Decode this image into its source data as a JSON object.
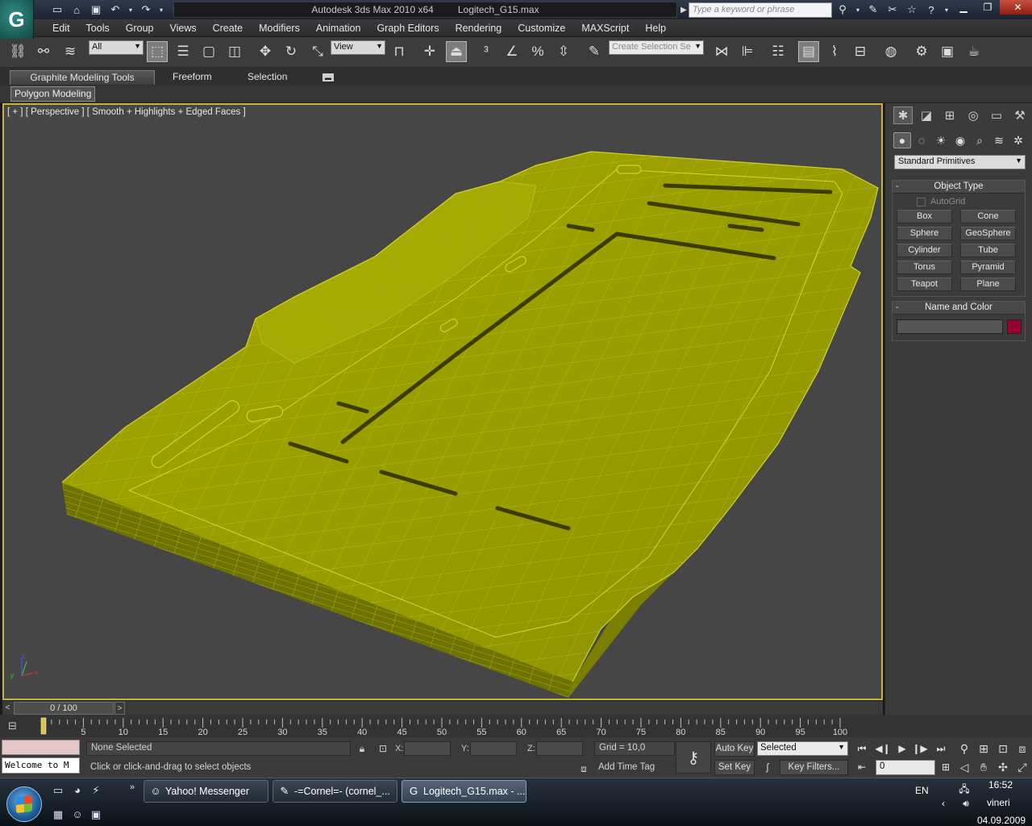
{
  "titlebar": {
    "app_name": "Autodesk 3ds Max  2010 x64",
    "file_name": "Logitech_G15.max",
    "search_placeholder": "Type a keyword or phrase"
  },
  "menu": [
    "Edit",
    "Tools",
    "Group",
    "Views",
    "Create",
    "Modifiers",
    "Animation",
    "Graph Editors",
    "Rendering",
    "Customize",
    "MAXScript",
    "Help"
  ],
  "toolbar": {
    "filter_value": "All",
    "coord_system": "View",
    "selection_set_placeholder": "Create Selection Se"
  },
  "ribbon": {
    "tabs": [
      "Graphite Modeling Tools",
      "Freeform",
      "Selection"
    ],
    "panel": "Polygon Modeling"
  },
  "viewport": {
    "label": "[ + ] [ Perspective ] [ Smooth + Highlights + Edged Faces ]",
    "mesh_color": "#9a9f00",
    "gizmo_axes": {
      "x": "x",
      "y": "y",
      "z": "z"
    }
  },
  "command_panel": {
    "category_dropdown": "Standard Primitives",
    "object_type_title": "Object Type",
    "autogrid_label": "AutoGrid",
    "object_buttons": [
      "Box",
      "Cone",
      "Sphere",
      "GeoSphere",
      "Cylinder",
      "Tube",
      "Torus",
      "Pyramid",
      "Teapot",
      "Plane"
    ],
    "name_color_title": "Name and Color",
    "object_color": "#990033"
  },
  "timeslider": {
    "position": "0 / 100"
  },
  "trackbar": {
    "ticks": [
      "5",
      "10",
      "15",
      "20",
      "25",
      "30",
      "35",
      "40",
      "45",
      "50",
      "55",
      "60",
      "65",
      "70",
      "75",
      "80",
      "85",
      "90",
      "95",
      "100"
    ]
  },
  "status": {
    "welcome": "Welcome to M",
    "selection": "None Selected",
    "prompt": "Click or click-and-drag to select objects",
    "x_label": "X:",
    "y_label": "Y:",
    "z_label": "Z:",
    "grid": "Grid = 10,0",
    "add_time_tag": "Add Time Tag",
    "auto_key": "Auto Key",
    "set_key": "Set Key",
    "key_mode": "Selected",
    "key_filters": "Key Filters...",
    "frame": "0"
  },
  "taskbar": {
    "tasks": [
      "Yahoo! Messenger",
      "-=Cornel=- (cornel_...",
      "Logitech_G15.max - ..."
    ],
    "language": "EN",
    "time": "16:52",
    "day": "vineri",
    "date": "04.09.2009"
  }
}
